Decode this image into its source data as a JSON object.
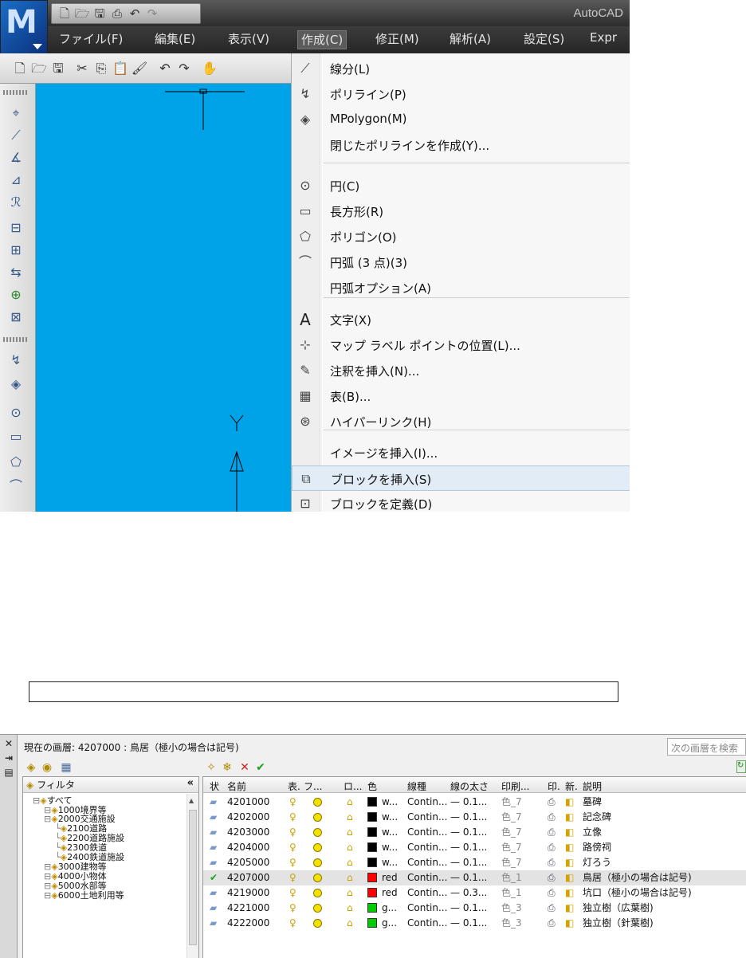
{
  "app": {
    "title": "AutoCAD",
    "logo_letter": "M"
  },
  "menubar": [
    "ファイル(F)",
    "編集(E)",
    "表示(V)",
    "作成(C)",
    "修正(M)",
    "解析(A)",
    "設定(S)",
    "Expr"
  ],
  "active_menu": "作成(C)",
  "dropdown": {
    "items": [
      {
        "label": "線分(L)",
        "icon": "line-icon"
      },
      {
        "label": "ポリライン(P)",
        "icon": "polyline-icon"
      },
      {
        "label": "MPolygon(M)",
        "icon": "mpolygon-icon"
      },
      {
        "label": "閉じたポリラインを作成(Y)...",
        "icon": ""
      },
      {
        "label": "円(C)",
        "icon": "circle-icon"
      },
      {
        "label": "長方形(R)",
        "icon": "rectangle-icon"
      },
      {
        "label": "ポリゴン(O)",
        "icon": "polygon-icon"
      },
      {
        "label": "円弧 (3 点)(3)",
        "icon": "arc-icon"
      },
      {
        "label": "円弧オプション(A)",
        "icon": ""
      },
      {
        "label": "文字(X)",
        "icon": "text-icon"
      },
      {
        "label": "マップ ラベル ポイントの位置(L)...",
        "icon": "map-label-icon"
      },
      {
        "label": "注釈を挿入(N)...",
        "icon": "annotation-icon"
      },
      {
        "label": "表(B)...",
        "icon": "table-icon"
      },
      {
        "label": "ハイパーリンク(H)",
        "icon": "hyperlink-icon"
      },
      {
        "label": "イメージを挿入(I)...",
        "icon": ""
      },
      {
        "label": "ブロックを挿入(S)",
        "icon": "insert-block-icon"
      },
      {
        "label": "ブロックを定義(D)",
        "icon": "define-block-icon"
      }
    ],
    "highlighted": "ブロックを挿入(S)"
  },
  "canvas": {
    "background": "#00a2e8",
    "ucs_y_label": "Y"
  },
  "layer_manager": {
    "current_layer": "現在の画層: 4207000 : 鳥居（極小の場合は記号)",
    "search_placeholder": "次の画層を検索",
    "filter_header": "フィルタ",
    "tree": [
      {
        "label": "すべて",
        "level": 0
      },
      {
        "label": "1000境界等",
        "level": 1
      },
      {
        "label": "2000交通施設",
        "level": 1
      },
      {
        "label": "2100道路",
        "level": 2
      },
      {
        "label": "2200道路施設",
        "level": 2
      },
      {
        "label": "2300鉄道",
        "level": 2
      },
      {
        "label": "2400鉄道施設",
        "level": 2
      },
      {
        "label": "3000建物等",
        "level": 1
      },
      {
        "label": "4000小物体",
        "level": 1
      },
      {
        "label": "5000水部等",
        "level": 1
      },
      {
        "label": "6000土地利用等",
        "level": 1
      }
    ],
    "columns": [
      "状",
      "名前",
      "表.",
      "フ...",
      "ロ...",
      "色",
      "線種",
      "線の太さ",
      "印刷...",
      "印.",
      "新.",
      "説明"
    ],
    "rows": [
      {
        "name": "4201000",
        "color": "w...",
        "swatch": "#000000",
        "linetype": "Contin...",
        "weight": "— 0.1...",
        "plot": "色_7",
        "desc": "墓碑",
        "current": false
      },
      {
        "name": "4202000",
        "color": "w...",
        "swatch": "#000000",
        "linetype": "Contin...",
        "weight": "— 0.1...",
        "plot": "色_7",
        "desc": "記念碑",
        "current": false
      },
      {
        "name": "4203000",
        "color": "w...",
        "swatch": "#000000",
        "linetype": "Contin...",
        "weight": "— 0.1...",
        "plot": "色_7",
        "desc": "立像",
        "current": false
      },
      {
        "name": "4204000",
        "color": "w...",
        "swatch": "#000000",
        "linetype": "Contin...",
        "weight": "— 0.1...",
        "plot": "色_7",
        "desc": "路傍祠",
        "current": false
      },
      {
        "name": "4205000",
        "color": "w...",
        "swatch": "#000000",
        "linetype": "Contin...",
        "weight": "— 0.1...",
        "plot": "色_7",
        "desc": "灯ろう",
        "current": false
      },
      {
        "name": "4207000",
        "color": "red",
        "swatch": "#ff0000",
        "linetype": "Contin...",
        "weight": "— 0.1...",
        "plot": "色_1",
        "desc": "鳥居（極小の場合は記号)",
        "current": true
      },
      {
        "name": "4219000",
        "color": "red",
        "swatch": "#ff0000",
        "linetype": "Contin...",
        "weight": "— 0.3...",
        "plot": "色_1",
        "desc": "坑口（極小の場合は記号)",
        "current": false
      },
      {
        "name": "4221000",
        "color": "g...",
        "swatch": "#00cc00",
        "linetype": "Contin...",
        "weight": "— 0.1...",
        "plot": "色_3",
        "desc": "独立樹（広葉樹)",
        "current": false
      },
      {
        "name": "4222000",
        "color": "g...",
        "swatch": "#00cc00",
        "linetype": "Contin...",
        "weight": "— 0.1...",
        "plot": "色_3",
        "desc": "独立樹（針葉樹)",
        "current": false
      }
    ]
  },
  "colors": {
    "canvas": "#00a2e8",
    "menu_highlight": "#e2ecf6",
    "current_check": "#1aa01a"
  }
}
